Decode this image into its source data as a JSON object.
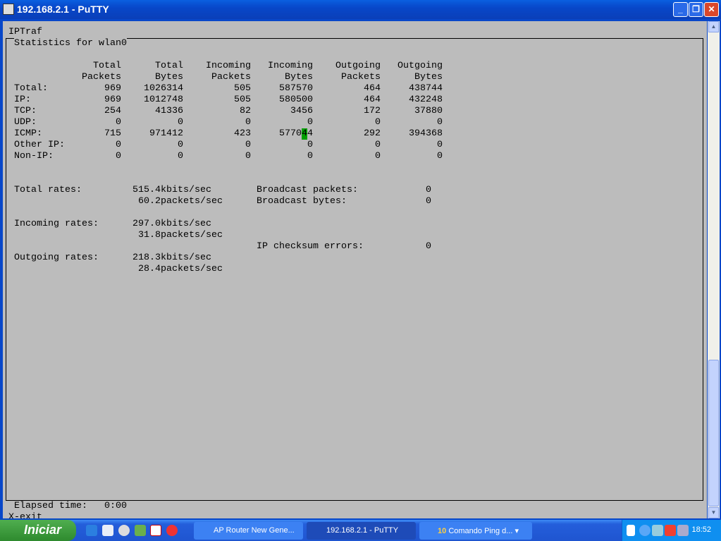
{
  "window": {
    "title": "192.168.2.1 - PuTTY"
  },
  "terminal": {
    "app_name": "IPTraf",
    "box_title": "Statistics for wlan0",
    "columns": [
      [
        "Total",
        "Packets"
      ],
      [
        "Total",
        "Bytes"
      ],
      [
        "Incoming",
        "Packets"
      ],
      [
        "Incoming",
        "Bytes"
      ],
      [
        "Outgoing",
        "Packets"
      ],
      [
        "Outgoing",
        "Bytes"
      ]
    ],
    "rows": [
      {
        "label": "Total:",
        "values": [
          "969",
          "1026314",
          "505",
          "587570",
          "464",
          "438744"
        ]
      },
      {
        "label": "IP:",
        "values": [
          "969",
          "1012748",
          "505",
          "580500",
          "464",
          "432248"
        ]
      },
      {
        "label": "TCP:",
        "values": [
          "254",
          "41336",
          "82",
          "3456",
          "172",
          "37880"
        ]
      },
      {
        "label": "UDP:",
        "values": [
          "0",
          "0",
          "0",
          "0",
          "0",
          "0"
        ]
      },
      {
        "label": "ICMP:",
        "values": [
          "715",
          "971412",
          "423",
          "577044",
          "292",
          "394368"
        ]
      },
      {
        "label": "Other IP:",
        "values": [
          "0",
          "0",
          "0",
          "0",
          "0",
          "0"
        ]
      },
      {
        "label": "Non-IP:",
        "values": [
          "0",
          "0",
          "0",
          "0",
          "0",
          "0"
        ]
      }
    ],
    "rates": {
      "total_label": "Total rates:",
      "total_kbits": "515.4",
      "total_pkts": "60.2",
      "incoming_label": "Incoming rates:",
      "incoming_kbits": "297.0",
      "incoming_pkts": "31.8",
      "outgoing_label": "Outgoing rates:",
      "outgoing_kbits": "218.3",
      "outgoing_pkts": "28.4",
      "kbits_unit": "kbits/sec",
      "pkts_unit": "packets/sec"
    },
    "broadcast_packets_label": "Broadcast packets:",
    "broadcast_packets": "0",
    "broadcast_bytes_label": "Broadcast bytes:",
    "broadcast_bytes": "0",
    "checksum_label": "IP checksum errors:",
    "checksum_errors": "0",
    "elapsed_label": "Elapsed time:",
    "elapsed": "0:00",
    "exit_hint": "X-exit",
    "cursor_color": "#00d800"
  },
  "taskbar": {
    "start": "Iniciar",
    "tasks": [
      {
        "label": "AP Router New Gene..."
      },
      {
        "label": "192.168.2.1 - PuTTY"
      },
      {
        "label": "Comando Ping d...",
        "count": "10"
      }
    ],
    "clock": "18:52"
  }
}
